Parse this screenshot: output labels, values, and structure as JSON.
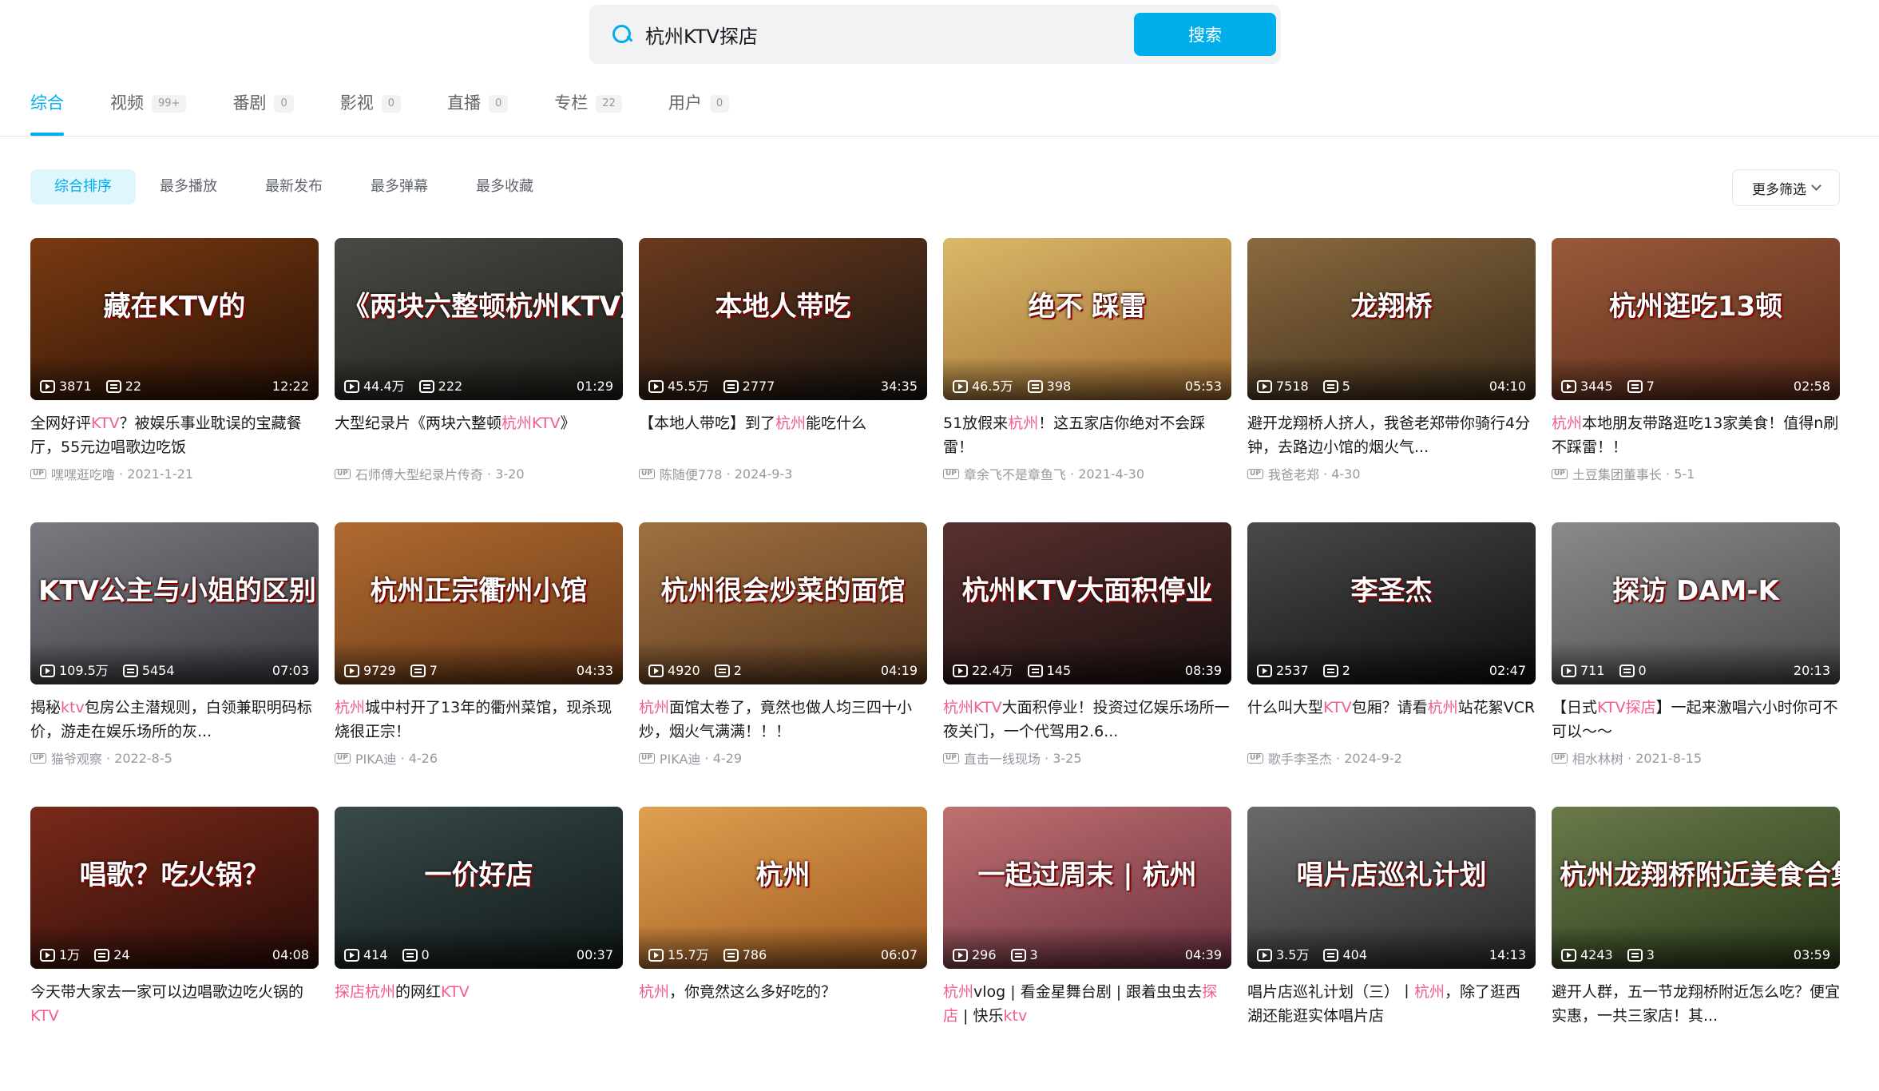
{
  "search": {
    "value": "杭州KTV探店",
    "button": "搜索"
  },
  "tabs": [
    {
      "label": "综合",
      "count": "",
      "active": true
    },
    {
      "label": "视频",
      "count": "99+"
    },
    {
      "label": "番剧",
      "count": "0"
    },
    {
      "label": "影视",
      "count": "0"
    },
    {
      "label": "直播",
      "count": "0"
    },
    {
      "label": "专栏",
      "count": "22"
    },
    {
      "label": "用户",
      "count": "0"
    }
  ],
  "filters": [
    {
      "label": "综合排序",
      "active": true
    },
    {
      "label": "最多播放"
    },
    {
      "label": "最新发布"
    },
    {
      "label": "最多弹幕"
    },
    {
      "label": "最多收藏"
    }
  ],
  "more_filter": "更多筛选",
  "up_label": "UP",
  "videos": [
    {
      "thumb_text": "藏在KTV的",
      "bg": [
        "#7a3a12",
        "#2a1206"
      ],
      "plays": "3871",
      "danmaku": "22",
      "duration": "12:22",
      "title_parts": [
        [
          "全网好评",
          false
        ],
        [
          "KTV",
          true
        ],
        [
          "？被娱乐事业耽误的宝藏餐厅，55元边唱歌边吃饭",
          false
        ]
      ],
      "author": "嘿嘿逛吃噜",
      "date": "2021-1-21"
    },
    {
      "thumb_text": "《两块六整顿杭州KTV》",
      "bg": [
        "#4a4a44",
        "#1e1e1a"
      ],
      "plays": "44.4万",
      "danmaku": "222",
      "duration": "01:29",
      "title_parts": [
        [
          "大型纪录片《两块六整顿",
          false
        ],
        [
          "杭州KTV",
          true
        ],
        [
          "》",
          false
        ]
      ],
      "author": "石师傅大型纪录片传奇",
      "date": "3-20"
    },
    {
      "thumb_text": "本地人带吃",
      "bg": [
        "#6b3a1e",
        "#181410"
      ],
      "plays": "45.5万",
      "danmaku": "2777",
      "duration": "34:35",
      "title_parts": [
        [
          "【本地人带吃】到了",
          false
        ],
        [
          "杭州",
          true
        ],
        [
          "能吃什么",
          false
        ]
      ],
      "author": "陈随便778",
      "date": "2024-9-3"
    },
    {
      "thumb_text": "绝不 踩雷",
      "bg": [
        "#d9b96a",
        "#a06a30"
      ],
      "plays": "46.5万",
      "danmaku": "398",
      "duration": "05:53",
      "title_parts": [
        [
          "51放假来",
          false
        ],
        [
          "杭州",
          true
        ],
        [
          "！这五家店你绝对不会踩雷！",
          false
        ]
      ],
      "author": "章余飞不是章鱼飞",
      "date": "2021-4-30"
    },
    {
      "thumb_text": "龙翔桥",
      "bg": [
        "#8a6a40",
        "#3a2a18"
      ],
      "plays": "7518",
      "danmaku": "5",
      "duration": "04:10",
      "title_parts": [
        [
          "避开龙翔桥人挤人，我爸老郑带你骑行4分钟，去路边小馆的烟火气...",
          false
        ]
      ],
      "author": "我爸老郑",
      "date": "4-30"
    },
    {
      "thumb_text": "杭州逛吃13顿",
      "bg": [
        "#9a5a3a",
        "#5a2a1a"
      ],
      "plays": "3445",
      "danmaku": "7",
      "duration": "02:58",
      "title_parts": [
        [
          "杭州",
          true
        ],
        [
          "本地朋友带路逛吃13家美食！值得n刷不踩雷！！",
          false
        ]
      ],
      "author": "土豆集团董事长",
      "date": "5-1"
    },
    {
      "thumb_text": "KTV公主与小姐的区别",
      "bg": [
        "#7a7a80",
        "#3a3a40"
      ],
      "plays": "109.5万",
      "danmaku": "5454",
      "duration": "07:03",
      "title_parts": [
        [
          "揭秘",
          false
        ],
        [
          "ktv",
          true
        ],
        [
          "包房公主潜规则，白领兼职明码标价，游走在娱乐场所的灰...",
          false
        ]
      ],
      "author": "猫爷观察",
      "date": "2022-8-5"
    },
    {
      "thumb_text": "杭州正宗衢州小馆",
      "bg": [
        "#b06a30",
        "#6a3a18"
      ],
      "plays": "9729",
      "danmaku": "7",
      "duration": "04:33",
      "title_parts": [
        [
          "杭州",
          true
        ],
        [
          "城中村开了13年的衢州菜馆，现杀现烧很正宗！",
          false
        ]
      ],
      "author": "PIKA迪",
      "date": "4-26"
    },
    {
      "thumb_text": "杭州很会炒菜的面馆",
      "bg": [
        "#a07040",
        "#5a3a20"
      ],
      "plays": "4920",
      "danmaku": "2",
      "duration": "04:19",
      "title_parts": [
        [
          "杭州",
          true
        ],
        [
          "面馆太卷了，竟然也做人均三四十小炒，烟火气满满！！！",
          false
        ]
      ],
      "author": "PIKA迪",
      "date": "4-29"
    },
    {
      "thumb_text": "杭州KTV大面积停业",
      "bg": [
        "#5a3030",
        "#1a1010"
      ],
      "plays": "22.4万",
      "danmaku": "145",
      "duration": "08:39",
      "title_parts": [
        [
          "杭州KTV",
          true
        ],
        [
          "大面积停业！投资过亿娱乐场所一夜关门，一个代驾用2.6...",
          false
        ]
      ],
      "author": "直击一线现场",
      "date": "3-25"
    },
    {
      "thumb_text": "李圣杰",
      "bg": [
        "#4a4a4a",
        "#0e0e0e"
      ],
      "plays": "2537",
      "danmaku": "2",
      "duration": "02:47",
      "title_parts": [
        [
          "什么叫大型",
          false
        ],
        [
          "KTV",
          true
        ],
        [
          "包厢？请看",
          false
        ],
        [
          "杭州",
          true
        ],
        [
          "站花絮VCR",
          false
        ]
      ],
      "author": "歌手李圣杰",
      "date": "2024-9-2"
    },
    {
      "thumb_text": "探访 DAM-K",
      "bg": [
        "#8a8a8a",
        "#4a4a4a"
      ],
      "plays": "711",
      "danmaku": "0",
      "duration": "20:13",
      "title_parts": [
        [
          "【日式",
          false
        ],
        [
          "KTV探店",
          true
        ],
        [
          "】一起来激唱六小时你可不可以～～",
          false
        ]
      ],
      "author": "相水林树",
      "date": "2021-8-15"
    },
    {
      "thumb_text": "唱歌？吃火锅？",
      "bg": [
        "#7a2a1a",
        "#2a0c08"
      ],
      "plays": "1万",
      "danmaku": "24",
      "duration": "04:08",
      "title_parts": [
        [
          "今天带大家去一家可以边唱歌边吃火锅的",
          false
        ],
        [
          "KTV",
          true
        ]
      ],
      "author": "",
      "date": ""
    },
    {
      "thumb_text": "一价好店",
      "bg": [
        "#3a4a4a",
        "#101818"
      ],
      "plays": "414",
      "danmaku": "0",
      "duration": "00:37",
      "title_parts": [
        [
          "探店杭州",
          true
        ],
        [
          "的网红",
          false
        ],
        [
          "KTV",
          true
        ]
      ],
      "author": "",
      "date": ""
    },
    {
      "thumb_text": "杭州",
      "bg": [
        "#e0a050",
        "#a05a20"
      ],
      "plays": "15.7万",
      "danmaku": "786",
      "duration": "06:07",
      "title_parts": [
        [
          "杭州",
          true
        ],
        [
          "，你竟然这么多好吃的？",
          false
        ]
      ],
      "author": "",
      "date": ""
    },
    {
      "thumb_text": "一起过周末 | 杭州",
      "bg": [
        "#c07070",
        "#6a3040"
      ],
      "plays": "296",
      "danmaku": "3",
      "duration": "04:39",
      "title_parts": [
        [
          "杭州",
          true
        ],
        [
          "vlog | 看金星舞台剧 | 跟着虫虫去",
          false
        ],
        [
          "探店",
          true
        ],
        [
          " | 快乐",
          false
        ],
        [
          "ktv",
          true
        ]
      ],
      "author": "",
      "date": ""
    },
    {
      "thumb_text": "唱片店巡礼计划",
      "bg": [
        "#6a6a6a",
        "#2a2a2a"
      ],
      "plays": "3.5万",
      "danmaku": "404",
      "duration": "14:13",
      "title_parts": [
        [
          "唱片店巡礼计划（三）丨",
          false
        ],
        [
          "杭州",
          true
        ],
        [
          "，除了逛西湖还能逛实体唱片店",
          false
        ]
      ],
      "author": "",
      "date": ""
    },
    {
      "thumb_text": "杭州龙翔桥附近美食合集",
      "bg": [
        "#6a7a4a",
        "#2a3a1a"
      ],
      "plays": "4243",
      "danmaku": "3",
      "duration": "03:59",
      "title_parts": [
        [
          "避开人群，五一节龙翔桥附近怎么吃？便宜实惠，一共三家店！其...",
          false
        ]
      ],
      "author": "",
      "date": ""
    }
  ]
}
